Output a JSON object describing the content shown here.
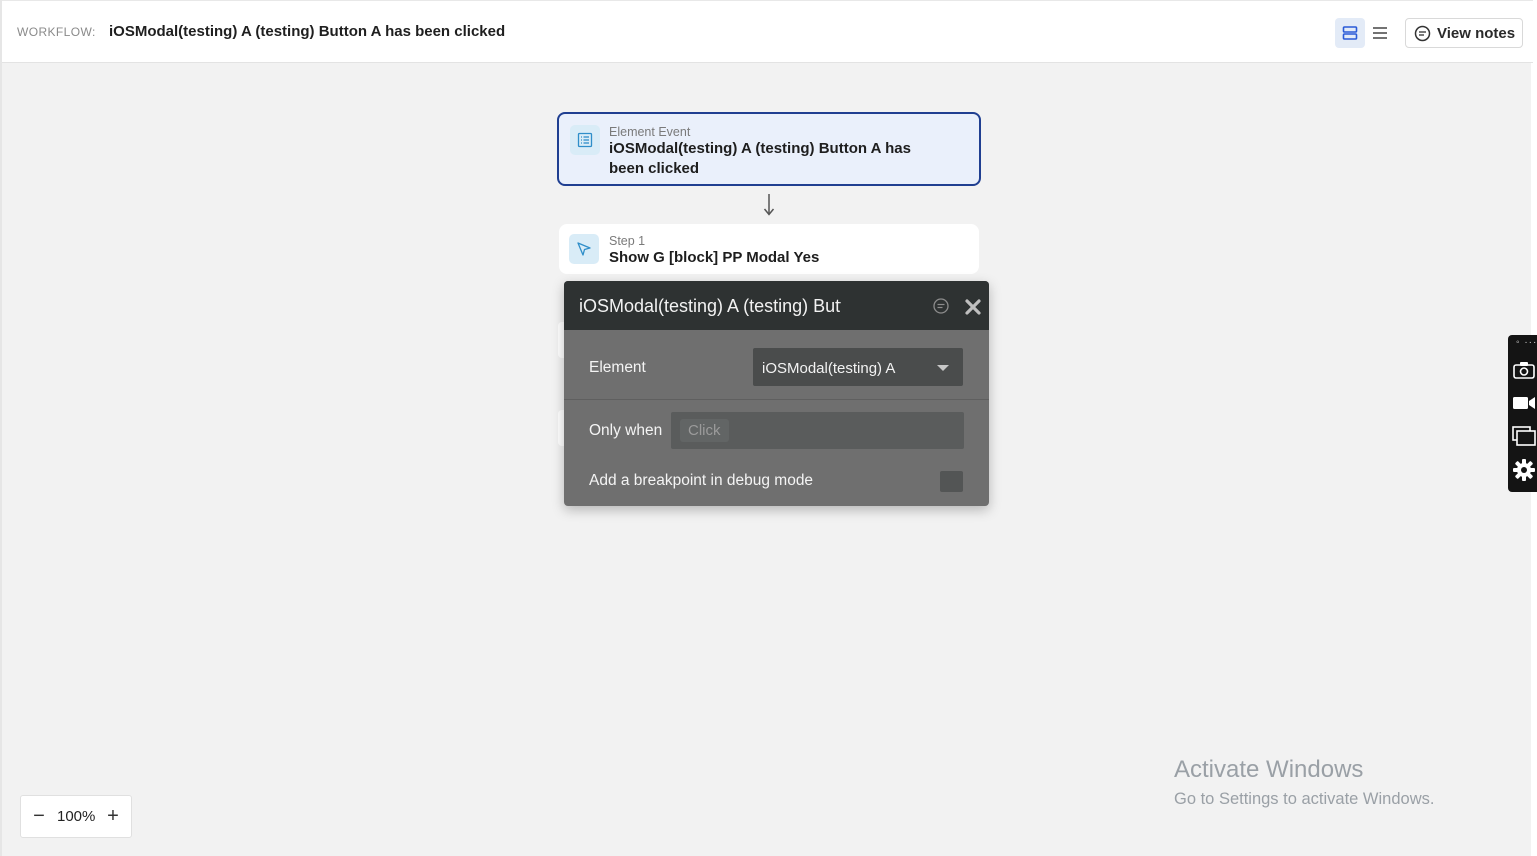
{
  "header": {
    "workflow_label": "WORKFLOW:",
    "workflow_title": "iOSModal(testing) A (testing) Button A has been clicked",
    "view_notes_label": "View notes"
  },
  "canvas": {
    "event_card": {
      "kind": "Element Event",
      "name": "iOSModal(testing) A (testing) Button A has been clicked"
    },
    "step_card": {
      "kind": "Step 1",
      "name": "Show G [block] PP Modal Yes"
    }
  },
  "editor": {
    "title": "iOSModal(testing) A (testing) Button A has been clicked",
    "element_label": "Element",
    "element_value": "iOSModal(testing) A",
    "only_when_label": "Only when",
    "only_when_placeholder": "Click",
    "breakpoint_label": "Add a breakpoint in debug mode"
  },
  "watermark": {
    "title": "Activate Windows",
    "subtitle": "Go to Settings to activate Windows."
  },
  "zoom": {
    "minus": "−",
    "value": "100%",
    "plus": "+"
  },
  "colors": {
    "accent": "#203f91",
    "editor_bg": "#6f6f6f",
    "editor_head": "#2e3232",
    "canvas_bg": "#f2f2f2"
  }
}
